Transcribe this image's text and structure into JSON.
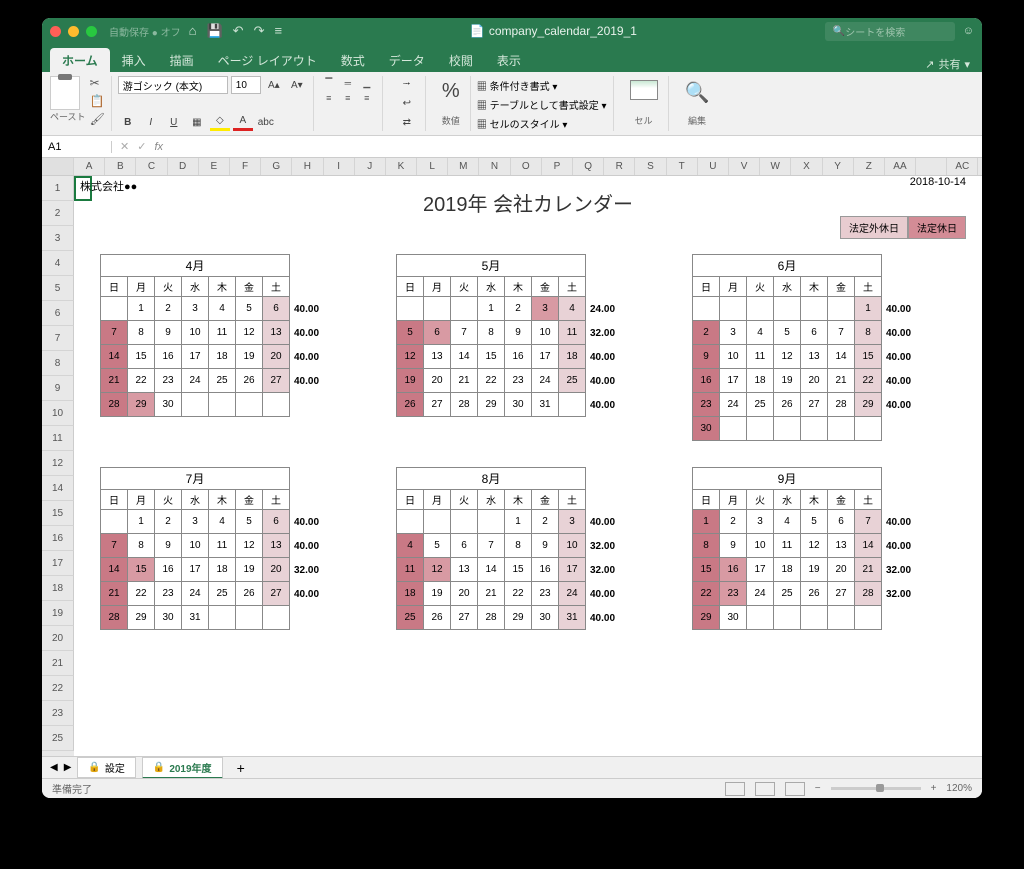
{
  "titlebar": {
    "autosave": "自動保存 ● オフ",
    "filename": "company_calendar_2019_1",
    "search_placeholder": "シートを検索"
  },
  "tabs": {
    "items": [
      "ホーム",
      "挿入",
      "描画",
      "ページ レイアウト",
      "数式",
      "データ",
      "校閲",
      "表示"
    ],
    "share": "共有"
  },
  "ribbon": {
    "paste": "ペースト",
    "font_name": "游ゴシック (本文)",
    "font_size": "10",
    "number": "数値",
    "cond_format": "条件付き書式",
    "table_format": "テーブルとして書式設定",
    "cell_styles": "セルのスタイル",
    "cells": "セル",
    "edit": "編集"
  },
  "namebox": {
    "cell": "A1"
  },
  "columns": [
    "A",
    "B",
    "C",
    "D",
    "E",
    "F",
    "G",
    "H",
    "I",
    "J",
    "K",
    "L",
    "M",
    "N",
    "O",
    "P",
    "Q",
    "R",
    "S",
    "T",
    "U",
    "V",
    "W",
    "X",
    "Y",
    "Z",
    "AA",
    "",
    "AC"
  ],
  "rows": [
    "1",
    "2",
    "3",
    "4",
    "5",
    "6",
    "7",
    "8",
    "9",
    "10",
    "11",
    "12",
    "14",
    "15",
    "16",
    "17",
    "18",
    "19",
    "20",
    "21",
    "22",
    "23",
    "25"
  ],
  "calendar": {
    "company": "株式会社●●",
    "date": "2018-10-14",
    "title": "2019年 会社カレンダー",
    "legend1": "法定外休日",
    "legend2": "法定休日",
    "dow": [
      "日",
      "月",
      "火",
      "水",
      "木",
      "金",
      "土"
    ],
    "months": [
      {
        "name": "4月",
        "offset": 1,
        "days": 30,
        "hours": [
          "40.00",
          "40.00",
          "40.00",
          "40.00"
        ],
        "red": [
          7,
          14,
          21,
          28
        ],
        "pink": [
          29
        ],
        "lite": [
          6,
          13,
          20,
          27
        ]
      },
      {
        "name": "5月",
        "offset": 3,
        "days": 31,
        "hours": [
          "24.00",
          "32.00",
          "40.00",
          "40.00",
          "40.00"
        ],
        "red": [
          5,
          12,
          19,
          26
        ],
        "pink": [
          3,
          6
        ],
        "lite": [
          4,
          11,
          18,
          25
        ]
      },
      {
        "name": "6月",
        "offset": 6,
        "days": 30,
        "hours": [
          "40.00",
          "40.00",
          "40.00",
          "40.00",
          "40.00"
        ],
        "red": [
          2,
          9,
          16,
          23,
          30
        ],
        "pink": [],
        "lite": [
          1,
          8,
          15,
          22,
          29
        ]
      },
      {
        "name": "7月",
        "offset": 1,
        "days": 31,
        "hours": [
          "40.00",
          "40.00",
          "32.00",
          "40.00"
        ],
        "red": [
          7,
          14,
          21,
          28
        ],
        "pink": [
          15
        ],
        "lite": [
          6,
          13,
          20,
          27
        ]
      },
      {
        "name": "8月",
        "offset": 4,
        "days": 31,
        "hours": [
          "40.00",
          "32.00",
          "32.00",
          "40.00",
          "40.00"
        ],
        "red": [
          4,
          11,
          18,
          25
        ],
        "pink": [
          12
        ],
        "lite": [
          3,
          10,
          17,
          24,
          31
        ]
      },
      {
        "name": "9月",
        "offset": 0,
        "days": 30,
        "hours": [
          "40.00",
          "40.00",
          "32.00",
          "32.00"
        ],
        "red": [
          1,
          8,
          15,
          22,
          29
        ],
        "pink": [
          16,
          23
        ],
        "lite": [
          7,
          14,
          21,
          28
        ]
      }
    ]
  },
  "sheets": {
    "tab1": "設定",
    "tab2": "2019年度"
  },
  "status": {
    "ready": "準備完了",
    "zoom": "120%"
  }
}
